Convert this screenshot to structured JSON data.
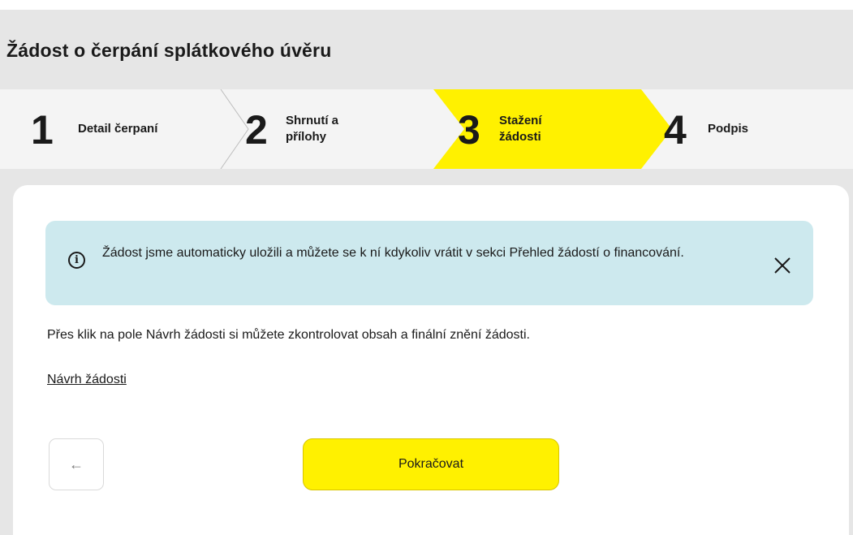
{
  "page": {
    "title": "Žádost o čerpání splátkového úvěru"
  },
  "stepper": {
    "current_step": 3,
    "steps": [
      {
        "number": "1",
        "label_line1": "Detail čerpaní",
        "label_line2": ""
      },
      {
        "number": "2",
        "label_line1": "Shrnutí a",
        "label_line2": "přílohy"
      },
      {
        "number": "3",
        "label_line1": "Stažení",
        "label_line2": "žádosti"
      },
      {
        "number": "4",
        "label_line1": "Podpis",
        "label_line2": ""
      }
    ]
  },
  "info_banner": {
    "icon": "info-icon",
    "icon_glyph": "i",
    "text": "Žádost jsme automaticky uložili a můžete se k ní kdykoliv vrátit v sekci  Přehled žádostí o financování.",
    "close_icon": "close-icon"
  },
  "main": {
    "description": "Přes klik na pole Návrh žádosti si můžete zkontrolovat obsah a finální znění žádosti.",
    "draft_link": "Návrh žádosti"
  },
  "actions": {
    "back_icon": "arrow-left-icon",
    "back_glyph": "←",
    "continue_label": "Pokračovat"
  },
  "colors": {
    "accent_yellow": "#fff100",
    "info_background": "#cde9ee",
    "header_background": "#e6e6e6"
  }
}
